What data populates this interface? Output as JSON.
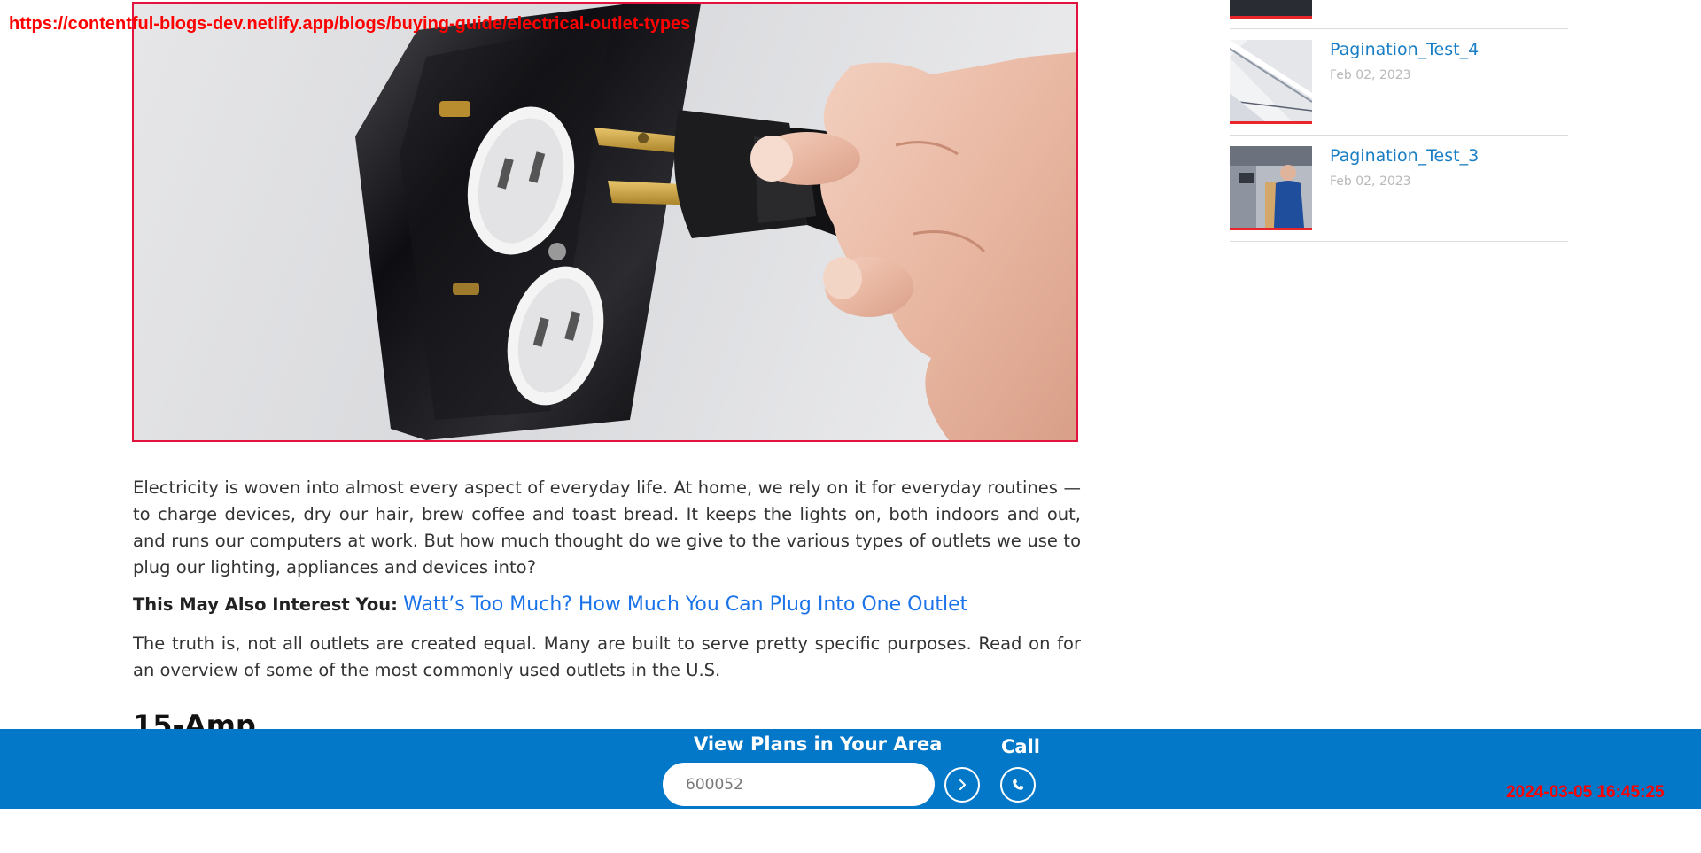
{
  "overlay": {
    "url": "https://contentful-blogs-dev.netlify.app/blogs/buying-guide/electrical-outlet-types",
    "timestamp": "2024-03-05 16:45:25"
  },
  "hero": {
    "image_subject": "hand plugging black three-prong plug into white duplex outlet on glossy black wall plate"
  },
  "article": {
    "paragraph_1": "Electricity is woven into almost every aspect of everyday life. At home, we rely on it for everyday routines — to charge devices, dry our hair, brew coffee and toast bread. It keeps the lights on, both indoors and out, and runs our computers at work. But how much thought do we give to the various types of outlets we use to plug our lighting, appliances and devices into?",
    "interest_label": "This May Also Interest You:",
    "interest_link": "Watt’s Too Much? How Much You Can Plug Into One Outlet",
    "paragraph_2": "The truth is, not all outlets are created equal. Many are built to serve pretty specific purposes. Read on for an overview of some of the most commonly used outlets in the U.S.",
    "section_heading": "15-Amp"
  },
  "sidebar": {
    "posts": [
      {
        "title": "Pagination_Test_4",
        "date": "Feb 02, 2023"
      },
      {
        "title": "Pagination_Test_3",
        "date": "Feb 02, 2023"
      }
    ]
  },
  "sticky_bar": {
    "plans_label": "View Plans in Your Area",
    "zip_value": "600052",
    "call_label": "Call"
  },
  "colors": {
    "bar_blue": "#0478c8",
    "link_blue": "#1a73e8",
    "sidebar_title": "#1a7ec4",
    "accent_red": "#e8262c"
  }
}
